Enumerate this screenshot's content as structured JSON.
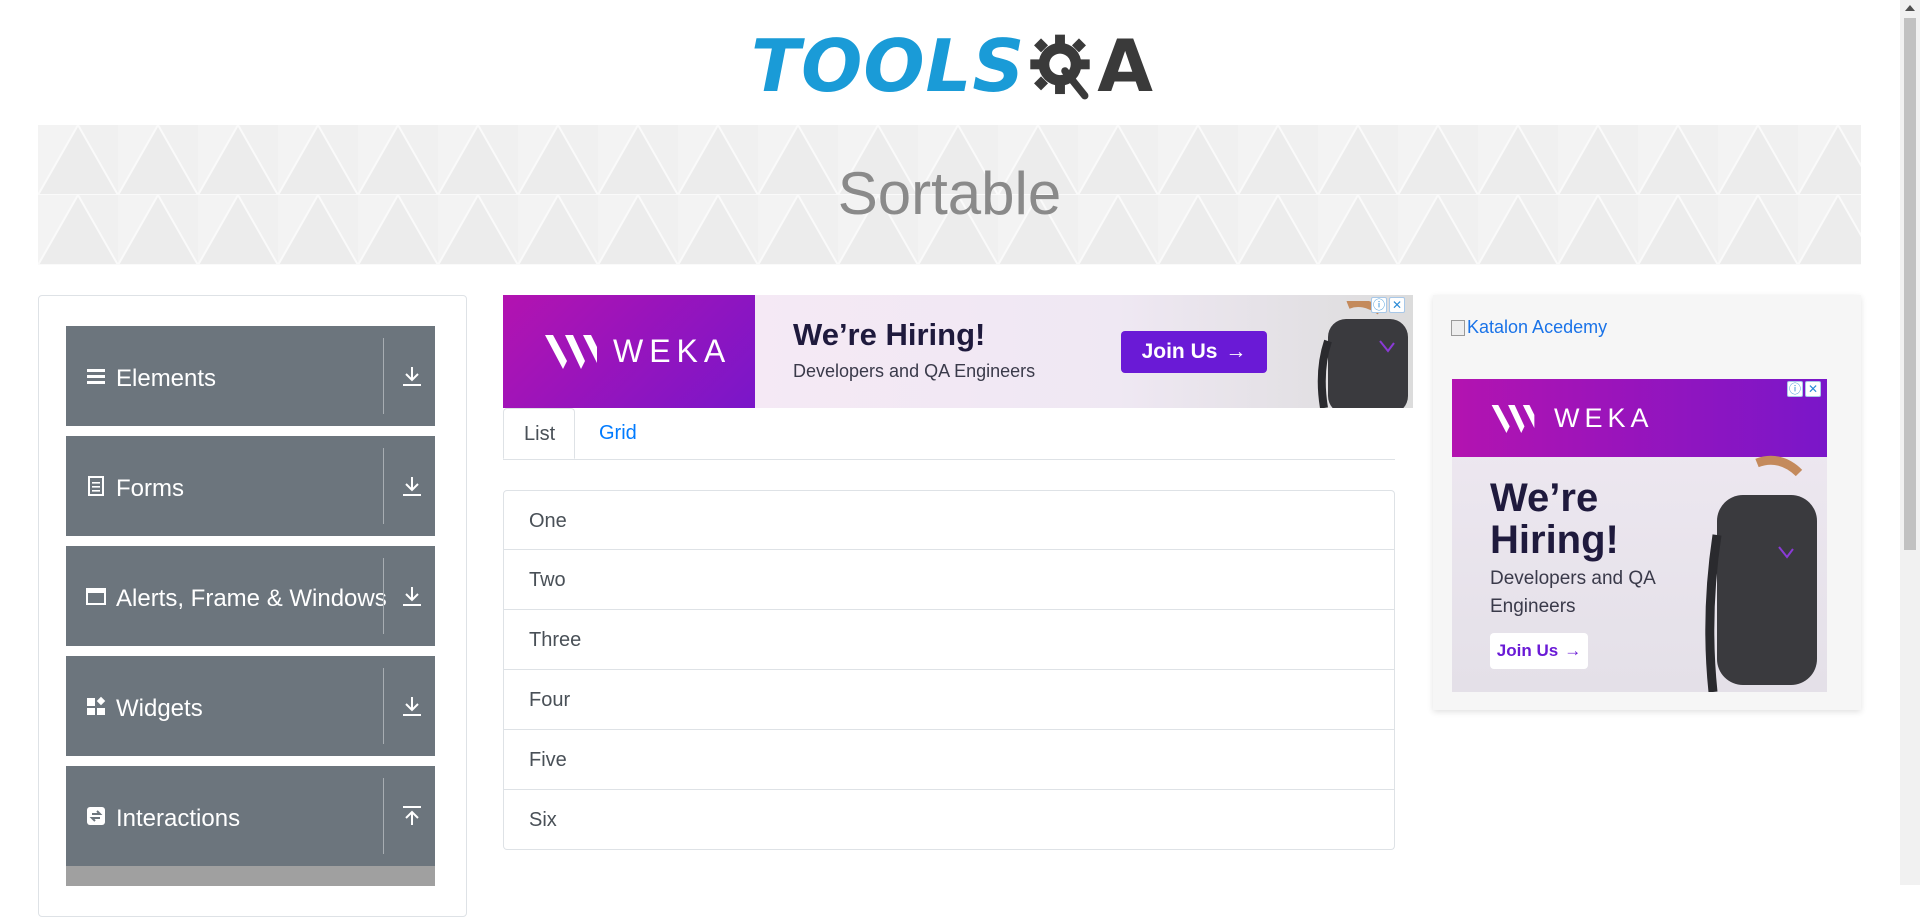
{
  "site": {
    "logo_text": "TOOLS",
    "logo_qa": "A"
  },
  "banner": {
    "title": "Sortable"
  },
  "nav": {
    "groups": [
      {
        "label": "Elements",
        "icon": "hamburger-icon",
        "state": "collapsed"
      },
      {
        "label": "Forms",
        "icon": "document-icon",
        "state": "collapsed"
      },
      {
        "label": "Alerts, Frame & Windows",
        "icon": "window-icon",
        "state": "collapsed"
      },
      {
        "label": "Widgets",
        "icon": "widgets-icon",
        "state": "collapsed"
      },
      {
        "label": "Interactions",
        "icon": "interactions-icon",
        "state": "expanded"
      }
    ]
  },
  "top_ad": {
    "brand": "WEKA",
    "headline": "We’re Hiring!",
    "subline": "Developers and QA Engineers",
    "cta": "Join Us"
  },
  "tabs": [
    {
      "label": "List",
      "active": true
    },
    {
      "label": "Grid",
      "active": false
    }
  ],
  "list_items": [
    "One",
    "Two",
    "Three",
    "Four",
    "Five",
    "Six"
  ],
  "side": {
    "broken_image_alt": "Katalon Acedemy",
    "ad": {
      "brand": "WEKA",
      "headline": "We’re Hiring!",
      "subline": "Developers and QA Engineers",
      "cta": "Join Us"
    }
  },
  "colors": {
    "nav_bg": "#6c757d",
    "link": "#007bff",
    "logo_blue": "#1a9bd7",
    "ad_purple": "#7a16c9"
  }
}
